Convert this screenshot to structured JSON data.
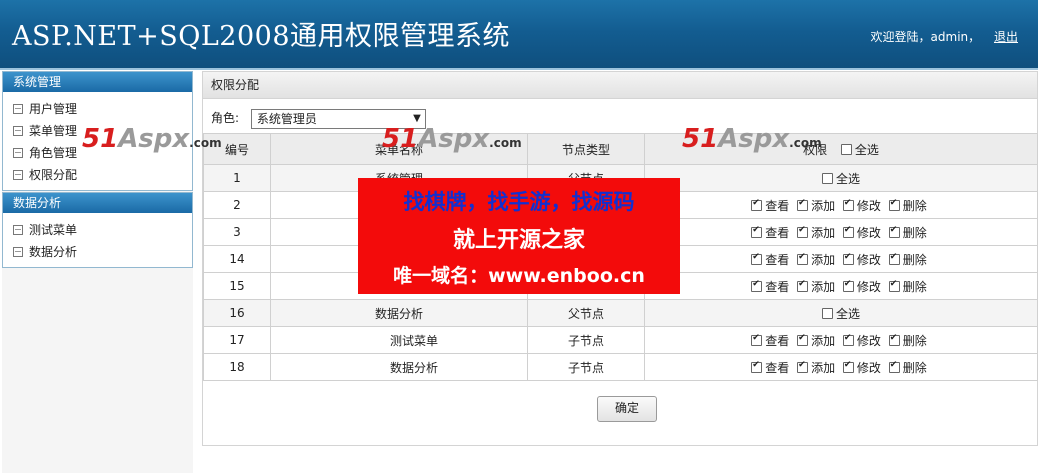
{
  "header": {
    "title": "ASP.NET+SQL2008通用权限管理系统",
    "welcome": "欢迎登陆，admin，",
    "logout": "退出"
  },
  "sidebar": {
    "panels": [
      {
        "title": "系统管理",
        "items": [
          "用户管理",
          "菜单管理",
          "角色管理",
          "权限分配"
        ]
      },
      {
        "title": "数据分析",
        "items": [
          "测试菜单",
          "数据分析"
        ]
      }
    ]
  },
  "main": {
    "header": "权限分配",
    "role_label": "角色:",
    "role_value": "系统管理员",
    "columns": [
      "编号",
      "菜单名称",
      "节点类型",
      "权限",
      "全选"
    ],
    "perm_labels": [
      "查看",
      "添加",
      "修改",
      "删除"
    ],
    "select_all": "全选",
    "rows": [
      {
        "id": "1",
        "name": "系统管理",
        "type": "父节点"
      },
      {
        "id": "2",
        "name": "",
        "type": ""
      },
      {
        "id": "3",
        "name": "",
        "type": ""
      },
      {
        "id": "14",
        "name": "",
        "type": ""
      },
      {
        "id": "15",
        "name": "",
        "type": ""
      },
      {
        "id": "16",
        "name": "数据分析",
        "type": "父节点"
      },
      {
        "id": "17",
        "name": "测试菜单",
        "type": "子节点"
      },
      {
        "id": "18",
        "name": "数据分析",
        "type": "子节点"
      }
    ],
    "confirm": "确定"
  },
  "watermark": {
    "num": "51",
    "brand": "Aspx",
    "suffix": ".com"
  },
  "ad": {
    "line1": "找棋牌，找手游，找源码",
    "line2": "就上开源之家",
    "line3": "唯一域名：www.enboo.cn"
  },
  "colors": {
    "header_bg": "#135d91",
    "panel_head": "#1a6aa6",
    "ad_bg": "#f30b0b",
    "ad_blue": "#1230d0"
  }
}
